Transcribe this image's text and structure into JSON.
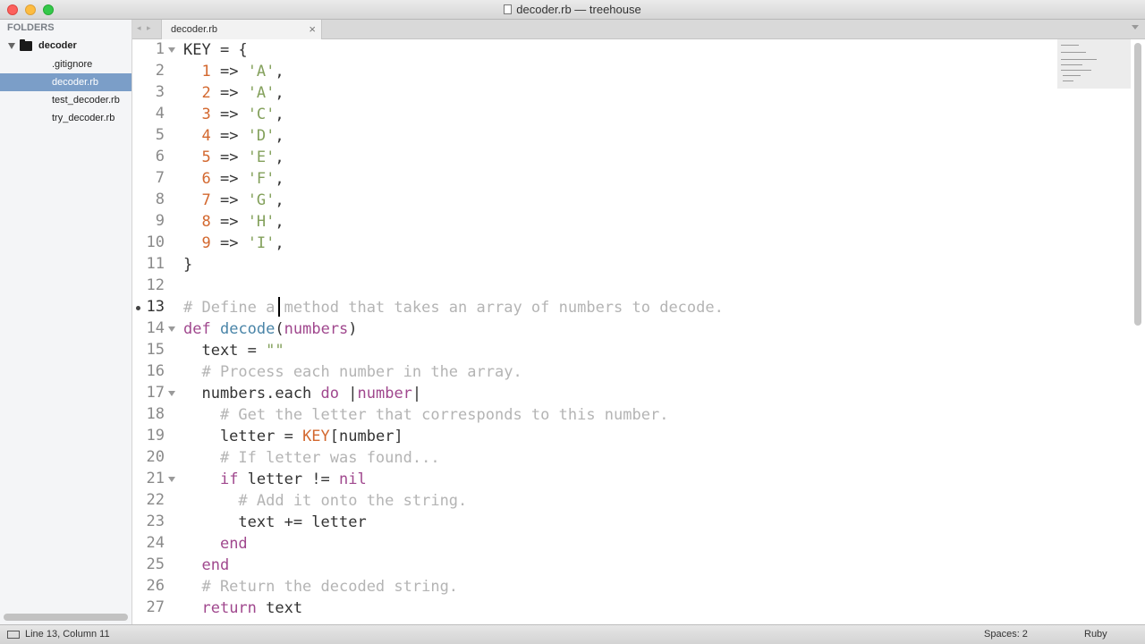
{
  "window": {
    "title": "decoder.rb — treehouse"
  },
  "sidebar": {
    "heading": "FOLDERS",
    "folder": "decoder",
    "files": [
      ".gitignore",
      "decoder.rb",
      "test_decoder.rb",
      "try_decoder.rb"
    ],
    "selected": "decoder.rb"
  },
  "tabs": [
    {
      "label": "decoder.rb",
      "close": "×"
    }
  ],
  "tab_nav": "◂ ▸",
  "editor": {
    "current_line": 13,
    "line_numbers": [
      "1",
      "2",
      "3",
      "4",
      "5",
      "6",
      "7",
      "8",
      "9",
      "10",
      "11",
      "12",
      "13",
      "14",
      "15",
      "16",
      "17",
      "18",
      "19",
      "20",
      "21",
      "22",
      "23",
      "24",
      "25",
      "26",
      "27"
    ],
    "lines": [
      "KEY = {",
      "  1 => 'A',",
      "  2 => 'A',",
      "  3 => 'C',",
      "  4 => 'D',",
      "  5 => 'E',",
      "  6 => 'F',",
      "  7 => 'G',",
      "  8 => 'H',",
      "  9 => 'I',",
      "}",
      "",
      "# Define a method that takes an array of numbers to decode.",
      "def decode(numbers)",
      "  text = \"\"",
      "  # Process each number in the array.",
      "  numbers.each do |number|",
      "    # Get the letter that corresponds to this number.",
      "    letter = KEY[number]",
      "    # If letter was found...",
      "    if letter != nil",
      "      # Add it onto the string.",
      "      text += letter",
      "    end",
      "  end",
      "  # Return the decoded string.",
      "  return text"
    ]
  },
  "status": {
    "position": "Line 13, Column 11",
    "indentation": "Spaces: 2",
    "syntax": "Ruby"
  }
}
